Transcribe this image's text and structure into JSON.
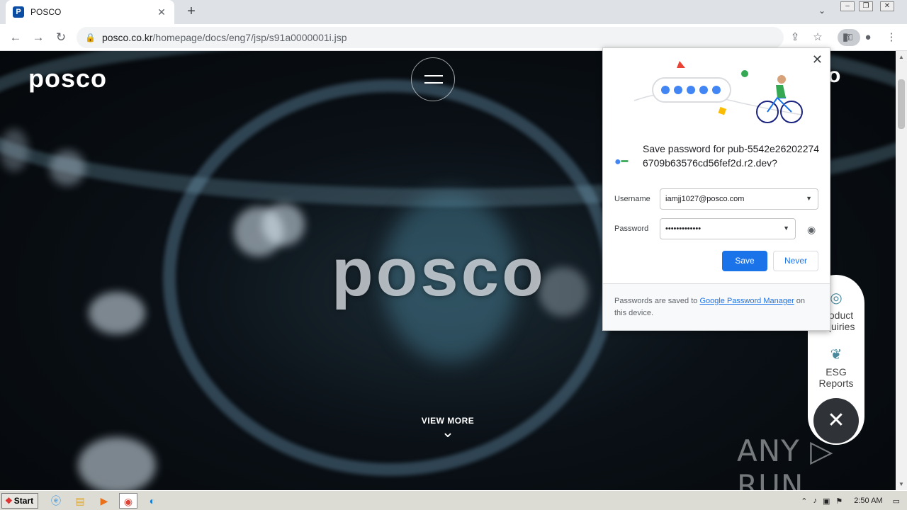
{
  "browser": {
    "tab_title": "POSCO",
    "tab_favicon": "P",
    "new_tab": "+",
    "url_host": "posco.co.kr",
    "url_path": "/homepage/docs/eng7/jsp/s91a0000001i.jsp"
  },
  "page": {
    "logo": "posco",
    "center_logo": "posco",
    "top_right_glyph": "o",
    "view_more": "VIEW MORE",
    "view_more_chevron": "⌄",
    "quick_panel": {
      "product": "Product Inquiries",
      "esg": "ESG Reports"
    },
    "close_glyph": "✕",
    "watermark": "ANY ▷ RUN"
  },
  "password_bubble": {
    "title": "Save password for pub-5542e262022746709b63576cd56fef2d.r2.dev?",
    "username_label": "Username",
    "username_value": "iamjj1027@posco.com",
    "password_label": "Password",
    "password_value": "•••••••••••••",
    "save_label": "Save",
    "never_label": "Never",
    "footer_prefix": "Passwords are saved to ",
    "footer_link": "Google Password Manager",
    "footer_suffix": " on this device."
  },
  "taskbar": {
    "start_label": "Start",
    "clock": "2:50 AM"
  },
  "colors": {
    "accent": "#1a73e8",
    "posco_blue": "#0a4da2"
  }
}
